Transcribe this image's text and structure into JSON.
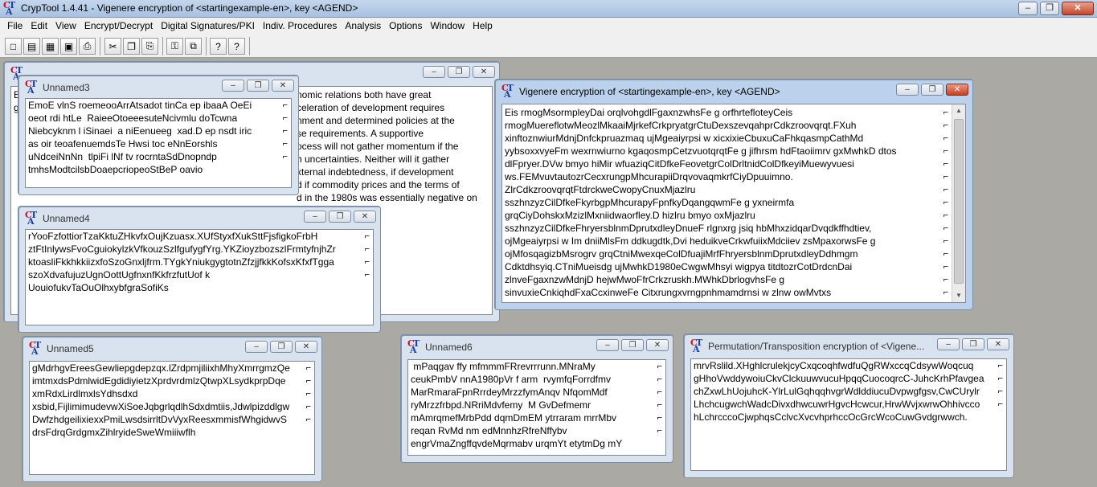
{
  "app": {
    "title": "CrypTool 1.4.41 - Vigenere encryption of <startingexample-en>, key <AGEND>",
    "controls": {
      "minimize": "‒",
      "restore": "❐",
      "close": "✕"
    }
  },
  "menu": [
    "File",
    "Edit",
    "View",
    "Encrypt/Decrypt",
    "Digital Signatures/PKI",
    "Indiv. Procedures",
    "Analysis",
    "Options",
    "Window",
    "Help"
  ],
  "toolbar": {
    "buttons": [
      {
        "name": "new-document-icon",
        "glyph": "□"
      },
      {
        "name": "open-folder-icon",
        "glyph": "▤"
      },
      {
        "name": "open-file-icon",
        "glyph": "▦"
      },
      {
        "name": "save-icon",
        "glyph": "▣"
      },
      {
        "name": "print-icon",
        "glyph": "⎙"
      },
      {
        "name": "cut-icon",
        "glyph": "✂"
      },
      {
        "name": "copy-icon",
        "glyph": "❐"
      },
      {
        "name": "paste-icon",
        "glyph": "⎘"
      },
      {
        "name": "key-icon",
        "glyph": "⚿"
      },
      {
        "name": "window-icon",
        "glyph": "⧉"
      },
      {
        "name": "help-icon",
        "glyph": "?"
      },
      {
        "name": "context-help-icon",
        "glyph": "?"
      }
    ]
  },
  "windows": {
    "starting": {
      "title": "startingexample-en",
      "lines": [
        "E",
        "g",
        "fi",
        "e",
        "g",
        "e",
        "o",
        "In",
        "d",
        "fi",
        "t"
      ],
      "right_lines": [
        "nomic relations both have great",
        "celeration of development requires",
        "nment and determined policies at the",
        "se requirements. A supportive",
        "ocess will not gather momentum if the",
        "h uncertainties. Neither will it gather",
        "xternal indebtedness, if development",
        "d if commodity prices and the terms of",
        "d in the 1980s was essentially negative on",
        "ded to create an",
        "rts are thus vital.",
        "pport - not to",
        "d developing"
      ]
    },
    "unnamed3": {
      "title": "Unnamed3",
      "lines": [
        "EmoE vlnS roemeooArrAtsadot tinCa ep ibaaA OeEi",
        "oeot rdi htLe  RaieeOtoeeesuteNcivmlu doTcwna",
        "Niebcyknm l iSinaei  a niEenueeg  xad.D ep nsdt iric",
        "as oir teoafenuemdsTe Hwsi toc eNnEorshls",
        "uNdceiNnNn  tlpiFi lNf tv rocrntaSdDnopndp",
        "tmhsModtcilsbDoaepcriopeoStBeP oavio"
      ]
    },
    "unnamed4": {
      "title": "Unnamed4",
      "lines": [
        "rYooFzfottiorTzaKktuZHkvfxOujKzuasx.XUfStyxfXukSttFjsfigkoFrbH",
        "ztFtInlywsFvoCguiokylzkVfkouzSzlfgufygfYrg.YKZioyzbozszlFrmtyfnjhZr",
        "ktoasliFkkhkkiizxfoSzoGnxljfrm.TYgkYniukgygtotnZfzjjfkkKofsxKfxfTgga",
        "szoXdvafujuzUgnOottUgfnxnfKkfrzfutUof k",
        "UouiofukvTaOuOlhxybfgraSofiKs"
      ]
    },
    "vigenere": {
      "title": "Vigenere encryption of <startingexample-en>, key <AGEND>",
      "lines": [
        "Eis rmogMsormpleyDai orqlvohgdlFgaxnzwhsFe g orfhrtefloteyCeis",
        "rmogMuereflotwMeozlMkaaiMjrkefCrkpryatgrCtuDexszevqahprCdkzroovqrqt.FXuh",
        "xinftoznwiurMdnjDnfckpruazmaq ujMgeaiyrpsi w xicxixieCbuxuCaFhkqasmpCathMd",
        "yybsoxxvyeFm wexrnwiurno kgaqosmpCetzvuotqrqtFe g jifhrsm hdFtaoiimrv gxMwhkD dtos",
        "dlFpryer.DVw bmyo hiMir wfuaziqCitDfkeFeovetgrColDrltnidColDfkeyiMuewyvuesi",
        "ws.FEMvuvtautozrCecxrungpMhcurapiiDrqvovaqmkrfCiyDpuuimno.",
        "ZlrCdkzroovqrqtFtdrckweCwopyCnuxMjazlru",
        "sszhnzyzCilDfkeFkyrbgpMhcurapyFpnfkyDqangqwmFe g yxneirmfa",
        "grqCiyDohskxMzizlMxniidwaorfley.D hizlru bmyo oxMjazlru",
        "sszhnzyzCilDfkeFhryersblnmDprutxdleyDnueF rlgnxrg jsiq hbMhxzidqarDvqdkffhdtiev,",
        "ojMgeaiyrpsi w Im dniiMlsFm ddkugdtk,Dvi heduikveCrkwfuiixMdciiev zsMpaxorwsFe g",
        "ojMfosqagizbMsrogrv grqCtniMwexqeColDfuajiMrfFhryersblnmDprutxdleyDdhmgm",
        "Cdktdhsyiq.CTniMueisdg ujMwhkD1980eCwgwMhsyi wigpya titdtozrCotDrdcnDai",
        "zlnveFgaxnzwMdnjD hejwMwoFfrCrkzruskh.MWhkDbrlogvhsFe g",
        "sinvuxieCnkiqhdFxaCcxinweFe Citxrungxvrngpnhmamdrnsi w zlnw owMvtxs"
      ]
    },
    "unnamed5": {
      "title": "Unnamed5",
      "lines": [
        "gMdrhgvEreesGewliepgdepzqx.lZrdpmjiliixhMhyXmrrgmzQe",
        "imtmxdsPdmlwidEgdidiyietzXprdvrdmlzQtwpXLsydkprpDqe",
        "xmRdxLirdlmxlsYdhsdxd",
        "xsbid,FijlimimudevwXiSoeJqbgrlqdlhSdxdmtiis,Jdwlpizddlgw",
        "DwfzhdgeilixiexxPmiLwsdsirrltDvVyxReesxmmisfWhgidwvS",
        "drsFdrqGrdgmxZihlryideSweWmiiiwflh"
      ]
    },
    "unnamed6": {
      "title": "Unnamed6",
      "lines": [
        " mPaqgav ffy mfmmmFRrevrrrunn.MNraMy",
        "ceukPmbV nnA1980pVr f arm  rvymfqForrdfmv",
        "MarRmaraFpnRrrdeyMrzzfymAnqv NfqomMdf",
        "ryMrzzfrbpd.NRriMdvfemy  M GvDefmemr",
        "mAmrqmefMrbPdd dqmDmEM ytrraram mrrMbv",
        "reqan RvMd nm edMnnhzRfreNffybv",
        "engrVmaZngffqvdeMqrmabv urqmYt etytmDg mY"
      ]
    },
    "permutation": {
      "title": "Permutation/Transposition encryption of <Vigene...",
      "lines": [
        "mrvRslild.XHghlcrulekjcyCxqcoqhfwdfuQgRWxccqCdsywWoqcuq",
        "gHhoVwddywoiuCkvClckuuwvucuHpqqCuocoqrcC-JuhcKrhPfavgea",
        "chZxwLhUojuhcK-YlrLulGqhqqhvgrWdlddiucuDvpwgfgsv,CwCUrylr",
        "LhchcugwchWadcDivxdhwcuwrHgvcHcwcur,HrwWvjxwrwOhhivcco",
        "hLchrcccoCjwphqsCclvcXvcvhprhccOcGrcWcoCuwGvdgrwwch."
      ]
    }
  }
}
